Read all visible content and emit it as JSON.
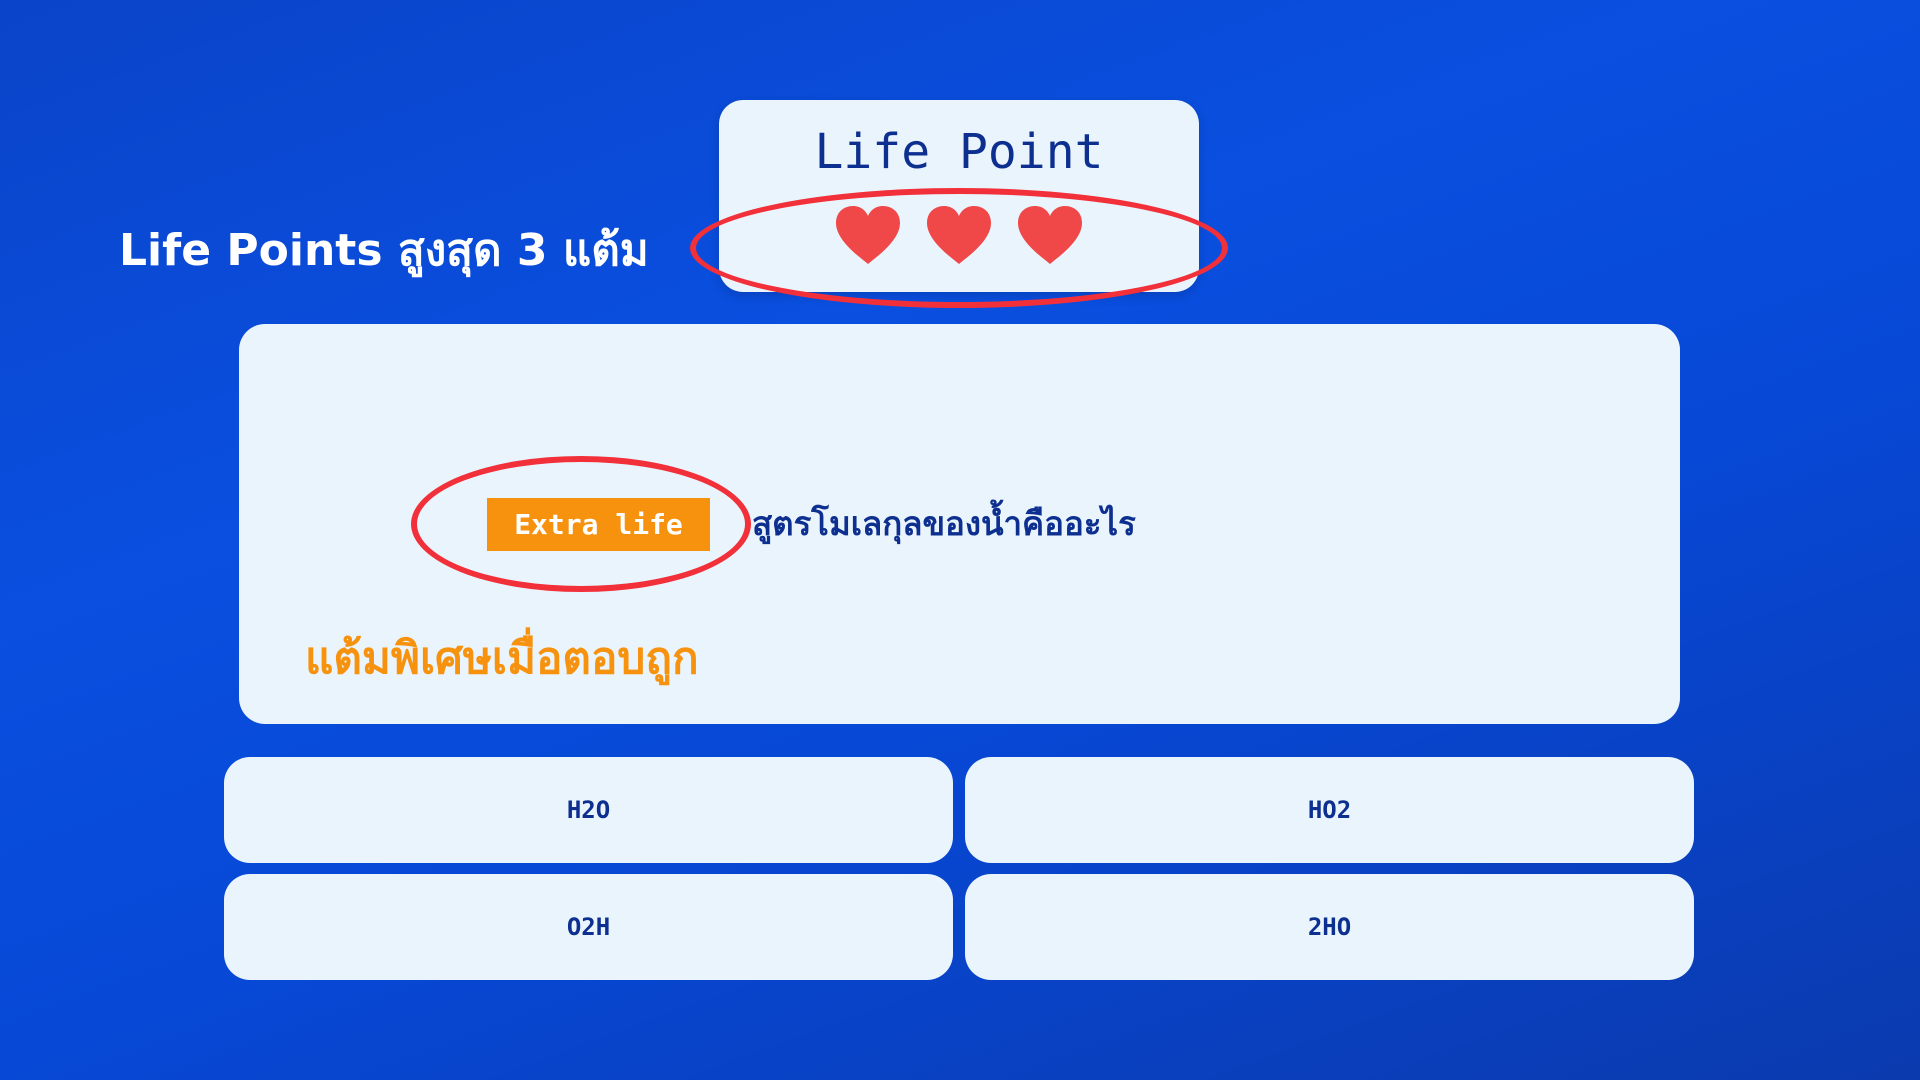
{
  "caption": "Life Points สูงสุด 3 แต้ม",
  "life_card": {
    "title": "Life Point",
    "hearts": [
      {
        "icon": "heart-icon",
        "color": "#f04848"
      },
      {
        "icon": "heart-icon",
        "color": "#f04848"
      },
      {
        "icon": "heart-icon",
        "color": "#f04848"
      }
    ]
  },
  "question": {
    "badge": "Extra life",
    "text": "สูตรโมเลกุลของน้ำคืออะไร",
    "bonus_note": "แต้มพิเศษเมื่อตอบถูก"
  },
  "answers": [
    "H2O",
    "HO2",
    "O2H",
    "2HO"
  ],
  "colors": {
    "background": "#0a4fe0",
    "card": "#eaf4fc",
    "text_dark": "#0d2f8f",
    "accent_orange": "#f7920e",
    "highlight_ring": "#f2303a",
    "heart": "#f04848"
  }
}
